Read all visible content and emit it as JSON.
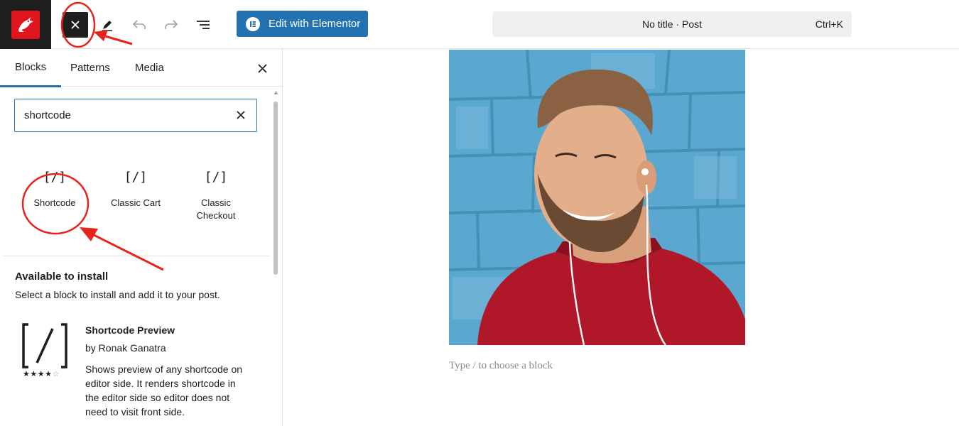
{
  "toolbar": {
    "elementor_label": "Edit with Elementor",
    "command_title": "No title · Post",
    "command_shortcut": "Ctrl+K"
  },
  "inserter": {
    "tabs": [
      {
        "label": "Blocks",
        "active": true
      },
      {
        "label": "Patterns",
        "active": false
      },
      {
        "label": "Media",
        "active": false
      }
    ],
    "search_value": "shortcode",
    "results": [
      {
        "icon": "[/]",
        "label": "Shortcode"
      },
      {
        "icon": "[/]",
        "label": "Classic Cart"
      },
      {
        "icon": "[/]",
        "label": "Classic\nCheckout"
      }
    ],
    "available": {
      "title": "Available to install",
      "subtitle": "Select a block to install and add it to your post.",
      "plugin": {
        "name": "Shortcode Preview",
        "author": "by Ronak Ganatra",
        "rating": 4,
        "rating_max": 5,
        "description": "Shows preview of any shortcode on editor side. It renders shortcode in the editor side so editor does not need to visit front side."
      }
    }
  },
  "editor": {
    "placeholder": "Type / to choose a block"
  },
  "colors": {
    "accent": "#2271b1",
    "annotation": "#e8231a",
    "logo_bg": "#e0151d"
  }
}
